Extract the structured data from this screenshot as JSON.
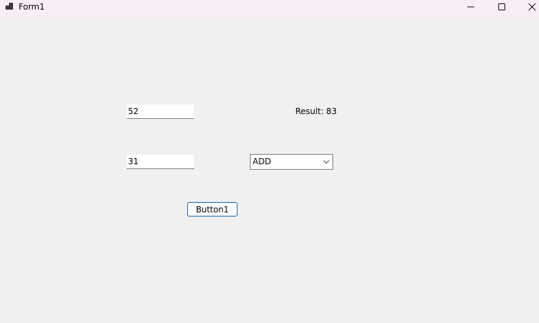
{
  "window": {
    "title": "Form1",
    "titlebar_color": "#f9eef7",
    "icons": {
      "app": "app-icon",
      "minimize": "minimize-icon",
      "maximize": "maximize-icon",
      "close": "close-icon"
    }
  },
  "form": {
    "textbox1_value": "52",
    "textbox2_value": "31",
    "result_label": "Result: 83",
    "operation_selected": "ADD",
    "button_label": "Button1"
  },
  "colors": {
    "form_background": "#f0f0f0",
    "button_border": "#0067c0"
  }
}
